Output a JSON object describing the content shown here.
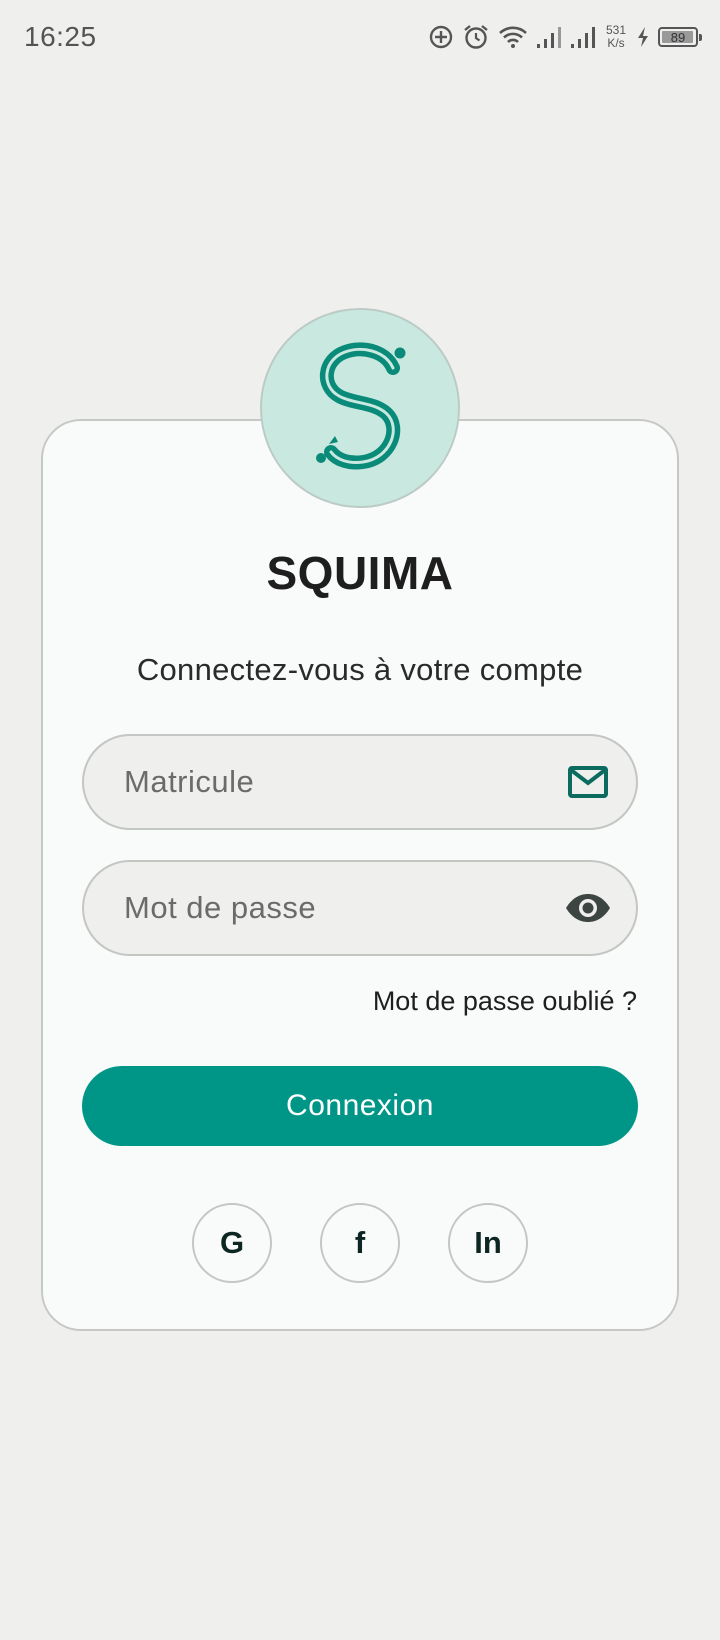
{
  "status_bar": {
    "time": "16:25",
    "net_speed_value": "531",
    "net_speed_unit": "K/s",
    "battery_level": "89",
    "icons": [
      "sync-icon",
      "alarm-icon",
      "wifi-icon",
      "signal-icon",
      "signal-icon",
      "charging-icon",
      "battery-icon"
    ]
  },
  "logo": {
    "icon": "squima-logo-icon"
  },
  "app": {
    "title": "SQUIMA",
    "subtitle": "Connectez-vous à votre compte"
  },
  "form": {
    "matricule_placeholder": "Matricule",
    "matricule_value": "",
    "matricule_icon": "mail-icon",
    "password_placeholder": "Mot de passe",
    "password_value": "",
    "password_icon": "eye-icon",
    "forgot_label": "Mot de passe oublié ?",
    "submit_label": "Connexion"
  },
  "social": {
    "google_label": "G",
    "facebook_label": "f",
    "linkedin_label": "In"
  },
  "colors": {
    "accent": "#009687",
    "logo_bg": "#c9e8e0",
    "background": "#eff0ee",
    "card": "#f9fbfa"
  }
}
